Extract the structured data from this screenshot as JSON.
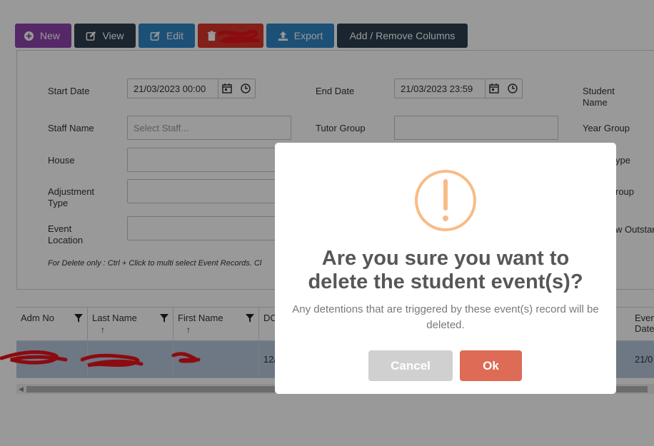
{
  "toolbar": {
    "new_label": "New",
    "view_label": "View",
    "edit_label": "Edit",
    "export_label": "Export",
    "columns_label": "Add / Remove Columns"
  },
  "filters": {
    "start_date_label": "Start Date",
    "start_date_value": "21/03/2023 00:00",
    "end_date_label": "End Date",
    "end_date_value": "21/03/2023 23:59",
    "student_name_label": "Student Name",
    "staff_name_label": "Staff Name",
    "staff_placeholder": "Select Staff...",
    "tutor_group_label": "Tutor Group",
    "year_group_label": "Year Group",
    "house_label": "House",
    "adjustment_type_label": "Adjustment Type",
    "event_location_label": "Event Location",
    "right_type_label": "ype",
    "right_group_label": "roup",
    "right_outstanding_label": "w Outstar",
    "note": "For Delete only : Ctrl + Click to multi select Event Records. Cl"
  },
  "grid": {
    "columns": [
      {
        "label": "Adm No",
        "arrow": ""
      },
      {
        "label": "Last Name",
        "arrow": "↑"
      },
      {
        "label": "First Name",
        "arrow": "↑"
      },
      {
        "label": "DC",
        "arrow": ""
      },
      {
        "label": "Even Date",
        "arrow": ""
      }
    ],
    "row": {
      "dob_partial": "12/",
      "date_partial": "21/0"
    }
  },
  "dialog": {
    "title": "Are you sure you want to delete the student event(s)?",
    "text": "Any detentions that are triggered by these event(s) record will be deleted.",
    "cancel_label": "Cancel",
    "ok_label": "Ok"
  },
  "colors": {
    "new": "#8e44ad",
    "dark": "#2c3e50",
    "blue": "#2f86c6",
    "delete": "#d9362b",
    "warning": "#f8bb86",
    "ok": "#dd6b55",
    "cancel": "#d0d0d0",
    "selected_row": "#b8c6dd"
  }
}
